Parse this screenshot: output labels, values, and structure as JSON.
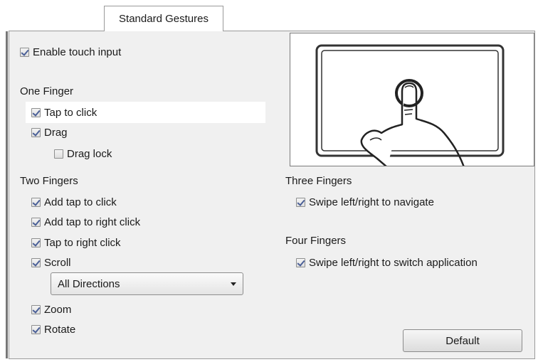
{
  "tab": {
    "label": "Standard Gestures"
  },
  "enable_touch": {
    "label": "Enable touch input",
    "checked": true
  },
  "one_finger": {
    "title": "One Finger",
    "items": [
      {
        "label": "Tap to click",
        "checked": true
      },
      {
        "label": "Drag",
        "checked": true
      },
      {
        "label": "Drag lock",
        "checked": false
      }
    ]
  },
  "two_fingers": {
    "title": "Two Fingers",
    "items": [
      {
        "label": "Add tap to click",
        "checked": true
      },
      {
        "label": "Add tap to right click",
        "checked": true
      },
      {
        "label": "Tap to right click",
        "checked": true
      },
      {
        "label": "Scroll",
        "checked": true
      },
      {
        "label": "Zoom",
        "checked": true
      },
      {
        "label": "Rotate",
        "checked": true
      }
    ],
    "scroll_select": {
      "value": "All Directions"
    }
  },
  "three_fingers": {
    "title": "Three Fingers",
    "items": [
      {
        "label": "Swipe left/right to navigate",
        "checked": true
      }
    ]
  },
  "four_fingers": {
    "title": "Four Fingers",
    "items": [
      {
        "label": "Swipe left/right to switch application",
        "checked": true
      }
    ]
  },
  "preview": {
    "icon": "touchpad-tap-gesture-icon"
  },
  "buttons": {
    "default_label": "Default"
  }
}
